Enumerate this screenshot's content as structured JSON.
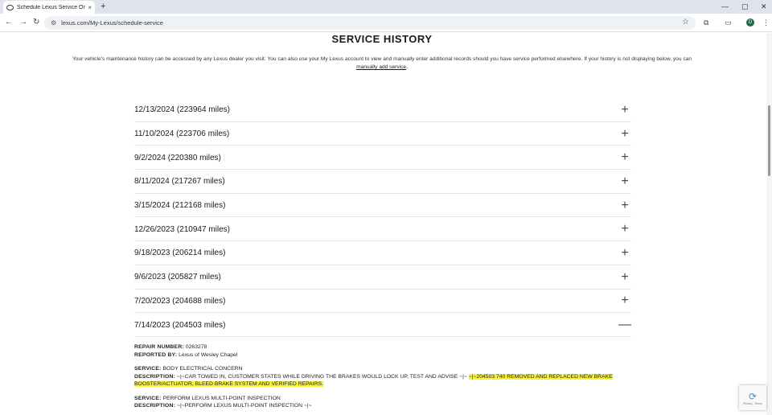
{
  "browser": {
    "tab_title": "Schedule Lexus Service Online",
    "tab_close": "×",
    "new_tab": "+",
    "url": "lexus.com/My-Lexus/schedule-service",
    "profile_initial": "D",
    "icons": {
      "back": "←",
      "forward": "→",
      "reload": "↻",
      "site_info": "⚙",
      "bookmark": "☆",
      "extensions": "⧉",
      "side_panel": "▭",
      "menu": "⋮",
      "minimize": "—",
      "maximize": "▢",
      "close": "✕"
    }
  },
  "page": {
    "title": "SERVICE HISTORY",
    "intro_text": "Your vehicle's maintenance history can be accessed by any Lexus dealer you visit. You can also use your My Lexus account to view and manually enter additional records should you have service performed elsewhere. If your history is not displaying below, you can ",
    "intro_link": "manually add service",
    "intro_end": "."
  },
  "history": [
    {
      "label": "12/13/2024 (223964 miles)",
      "toggle": "+"
    },
    {
      "label": "11/10/2024 (223706 miles)",
      "toggle": "+"
    },
    {
      "label": "9/2/2024 (220380 miles)",
      "toggle": "+"
    },
    {
      "label": "8/11/2024 (217267 miles)",
      "toggle": "+"
    },
    {
      "label": "3/15/2024 (212168 miles)",
      "toggle": "+"
    },
    {
      "label": "12/26/2023 (210947 miles)",
      "toggle": "+"
    },
    {
      "label": "9/18/2023 (206214 miles)",
      "toggle": "+"
    },
    {
      "label": "9/6/2023 (205827 miles)",
      "toggle": "+"
    },
    {
      "label": "7/20/2023 (204688 miles)",
      "toggle": "+"
    },
    {
      "label": "7/14/2023 (204503 miles)",
      "toggle": "—"
    }
  ],
  "detail": {
    "repair_number_label": "REPAIR NUMBER:",
    "repair_number": "0263278",
    "reported_by_label": "REPORTED BY:",
    "reported_by": "Lexus of Wesley Chapel",
    "service_label": "SERVICE:",
    "service_1": "BODY ELECTRICAL CONCERN",
    "description_label": "DESCRIPTION:",
    "description_1a": "~|~CAR TOWED IN, CUSTOMER STATES WHILE DRIVING THE BRAKES WOULD LOCK UP, TEST AND ADVISE ~|~ ",
    "description_1b": "~|~204503 740 REMOVED AND REPLACED NEW BRAKE BOOSTER/ACTUATOR, BLEED BRAKE SYSTEM AND VERIFIED REPAIRS.",
    "service_2": "PERFORM LEXUS MULTI-POINT INSPECTION",
    "description_2": "~|~PERFORM LEXUS MULTI-POINT INSPECTION ~|~"
  },
  "recaptcha": {
    "icon": "⟳",
    "footer": "Privacy - Terms"
  }
}
